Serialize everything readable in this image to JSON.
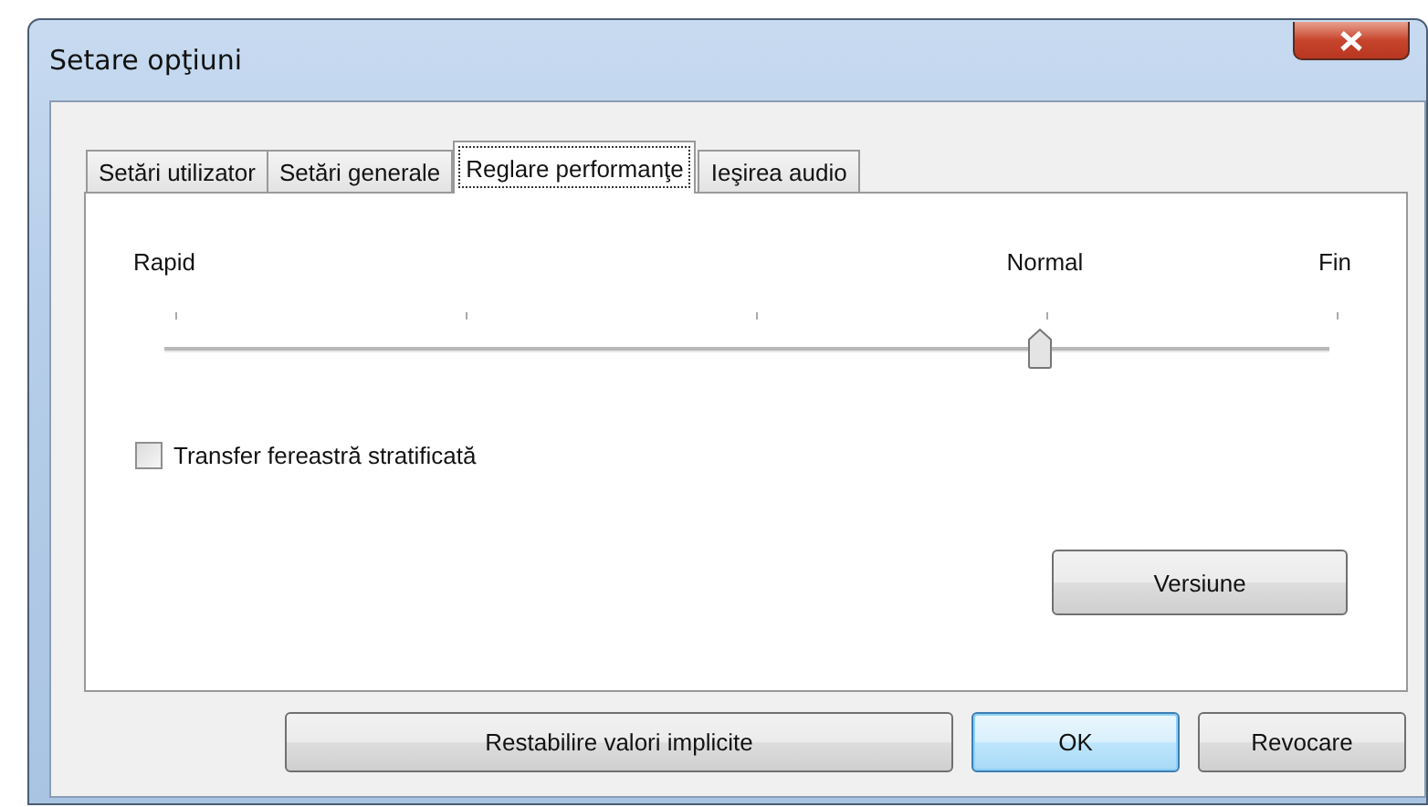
{
  "window": {
    "title": "Setare opţiuni"
  },
  "tabs": [
    {
      "label": "Setări utilizator",
      "selected": false
    },
    {
      "label": "Setări generale",
      "selected": false
    },
    {
      "label": "Reglare performanţe",
      "selected": true
    },
    {
      "label": "Ieşirea audio",
      "selected": false
    }
  ],
  "slider": {
    "labels": [
      "Rapid",
      "Normal",
      "Fin"
    ],
    "level": 0.75
  },
  "checkbox": {
    "label": "Transfer fereastră stratificată",
    "checked": false
  },
  "panel_button": "Versiune",
  "buttons": [
    {
      "label": "Restabilire valori implicite",
      "kind": "wide"
    },
    {
      "label": "OK",
      "kind": "default"
    },
    {
      "label": "Revocare",
      "kind": "normal"
    }
  ]
}
